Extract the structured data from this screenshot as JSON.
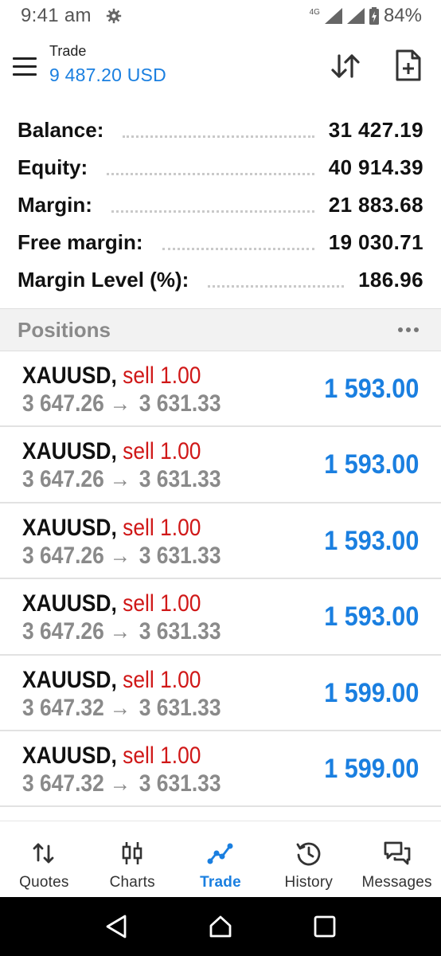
{
  "status_bar": {
    "time": "9:41 am",
    "network": "4G",
    "battery_percent": "84%",
    "icons": [
      "gear-icon",
      "signal-icon",
      "signal-icon",
      "battery-icon"
    ]
  },
  "app_bar": {
    "title": "Trade",
    "balance_display": "9 487.20 USD",
    "icons": [
      "menu-icon",
      "sort-icon",
      "new-order-icon"
    ]
  },
  "account": {
    "rows": [
      {
        "label": "Balance:",
        "value": "31 427.19"
      },
      {
        "label": "Equity:",
        "value": "40 914.39"
      },
      {
        "label": "Margin:",
        "value": "21 883.68"
      },
      {
        "label": "Free margin:",
        "value": "19 030.71"
      },
      {
        "label": "Margin Level (%):",
        "value": "186.96"
      }
    ]
  },
  "positions": {
    "title": "Positions",
    "items": [
      {
        "symbol": "XAUUSD,",
        "type": "sell 1.00",
        "open_price": "3 647.26",
        "arrow": "→",
        "current_price": "3 631.33",
        "profit": "1 593.00"
      },
      {
        "symbol": "XAUUSD,",
        "type": "sell 1.00",
        "open_price": "3 647.26",
        "arrow": "→",
        "current_price": "3 631.33",
        "profit": "1 593.00"
      },
      {
        "symbol": "XAUUSD,",
        "type": "sell 1.00",
        "open_price": "3 647.26",
        "arrow": "→",
        "current_price": "3 631.33",
        "profit": "1 593.00"
      },
      {
        "symbol": "XAUUSD,",
        "type": "sell 1.00",
        "open_price": "3 647.26",
        "arrow": "→",
        "current_price": "3 631.33",
        "profit": "1 593.00"
      },
      {
        "symbol": "XAUUSD,",
        "type": "sell 1.00",
        "open_price": "3 647.32",
        "arrow": "→",
        "current_price": "3 631.33",
        "profit": "1 599.00"
      },
      {
        "symbol": "XAUUSD,",
        "type": "sell 1.00",
        "open_price": "3 647.32",
        "arrow": "→",
        "current_price": "3 631.33",
        "profit": "1 599.00"
      }
    ]
  },
  "bottom_nav": {
    "items": [
      {
        "label": "Quotes",
        "icon": "quotes-icon"
      },
      {
        "label": "Charts",
        "icon": "charts-icon"
      },
      {
        "label": "Trade",
        "icon": "trade-icon",
        "active": true
      },
      {
        "label": "History",
        "icon": "history-icon"
      },
      {
        "label": "Messages",
        "icon": "messages-icon"
      }
    ]
  },
  "colors": {
    "accent_blue": "#1a7fe0",
    "sell_red": "#d01818",
    "muted_gray": "#8a8a8a"
  }
}
